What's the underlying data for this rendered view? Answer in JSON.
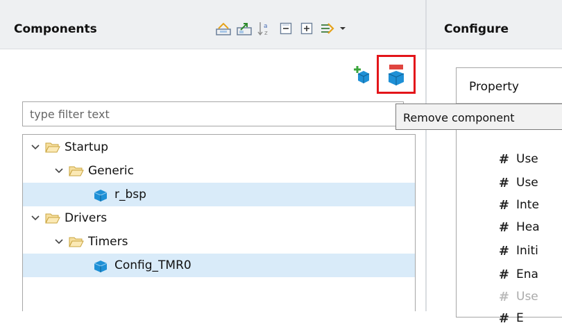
{
  "components_panel": {
    "title": "Components",
    "toolbar": [
      {
        "name": "collapse-all-icon"
      },
      {
        "name": "expand-icon"
      },
      {
        "name": "sort-az-icon"
      },
      {
        "name": "collapse-icon"
      },
      {
        "name": "expand-all-icon"
      },
      {
        "name": "link-filter-icon"
      },
      {
        "name": "view-menu-chevron-icon"
      }
    ],
    "filter_placeholder": "type filter text",
    "tree": [
      {
        "label": "Startup"
      },
      {
        "label": "Generic"
      },
      {
        "label": "r_bsp"
      },
      {
        "label": "Drivers"
      },
      {
        "label": "Timers"
      },
      {
        "label": "Config_TMR0"
      }
    ]
  },
  "configure_panel": {
    "title": "Configure",
    "property_header": "Property",
    "properties": [
      {
        "label": "Use"
      },
      {
        "label": "Use"
      },
      {
        "label": "Inte"
      },
      {
        "label": "Hea"
      },
      {
        "label": "Initi"
      },
      {
        "label": "Ena"
      },
      {
        "label": "Use"
      },
      {
        "label": "E"
      }
    ]
  },
  "tooltip": {
    "text": "Remove component"
  },
  "colors": {
    "highlight_border": "#e3151a",
    "selection": "#d9ebf9",
    "header_bg": "#eef0f2"
  }
}
